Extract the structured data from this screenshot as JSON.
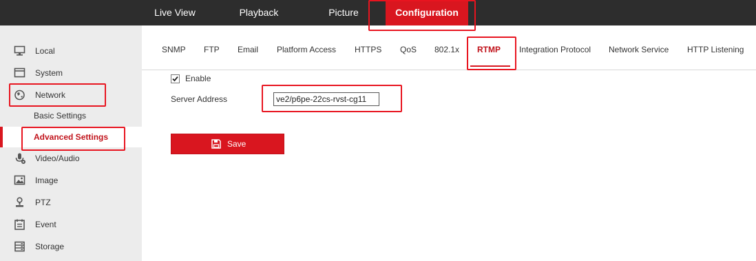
{
  "top_nav": {
    "live_view": "Live View",
    "playback": "Playback",
    "picture": "Picture",
    "configuration": "Configuration"
  },
  "sidebar": {
    "items": [
      {
        "label": "Local",
        "icon": "monitor-icon"
      },
      {
        "label": "System",
        "icon": "system-icon"
      },
      {
        "label": "Network",
        "icon": "globe-icon"
      },
      {
        "label": "Video/Audio",
        "icon": "microphone-icon"
      },
      {
        "label": "Image",
        "icon": "image-icon"
      },
      {
        "label": "PTZ",
        "icon": "ptz-icon"
      },
      {
        "label": "Event",
        "icon": "event-icon"
      },
      {
        "label": "Storage",
        "icon": "storage-icon"
      }
    ],
    "network_sub": {
      "basic": "Basic Settings",
      "advanced": "Advanced Settings"
    }
  },
  "tabs": [
    "SNMP",
    "FTP",
    "Email",
    "Platform Access",
    "HTTPS",
    "QoS",
    "802.1x",
    "RTMP",
    "Integration Protocol",
    "Network Service",
    "HTTP Listening"
  ],
  "active_tab": "RTMP",
  "form": {
    "enable_label": "Enable",
    "enable_checked": true,
    "server_address_label": "Server Address",
    "server_address_value": "ve2/p6pe-22cs-rvst-cg11"
  },
  "save_label": "Save",
  "colors": {
    "accent": "#d9161f",
    "topbar": "#2d2d2d",
    "sidebar": "#ececec",
    "highlight": "#e8141f"
  }
}
